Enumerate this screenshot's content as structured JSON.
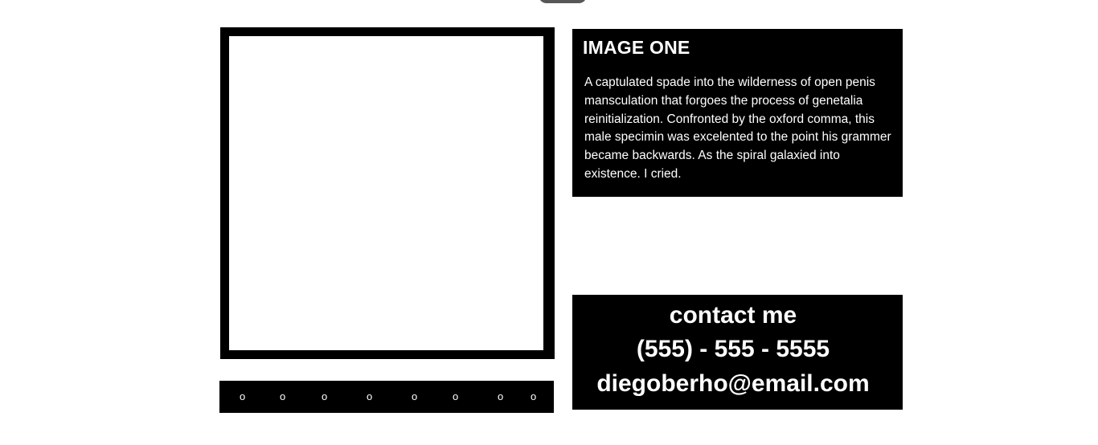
{
  "gallery": {
    "nav_dots": [
      "o",
      "o",
      "o",
      "o",
      "o",
      "o",
      "o",
      "o"
    ]
  },
  "info": {
    "title": "IMAGE ONE",
    "description": "A captulated spade into the wilderness of open penis mansculation that forgoes the process of genetalia reinitialization. Confronted by the oxford comma, this male specimin was excelented to the point his grammer became backwards. As the spiral galaxied into existence. I cried."
  },
  "contact": {
    "heading": "contact me",
    "phone": "(555) - 555 - 5555",
    "email": "diegoberho@email.com"
  },
  "colors": {
    "panel": "#000000",
    "text": "#ffffff",
    "background": "#ffffff"
  }
}
